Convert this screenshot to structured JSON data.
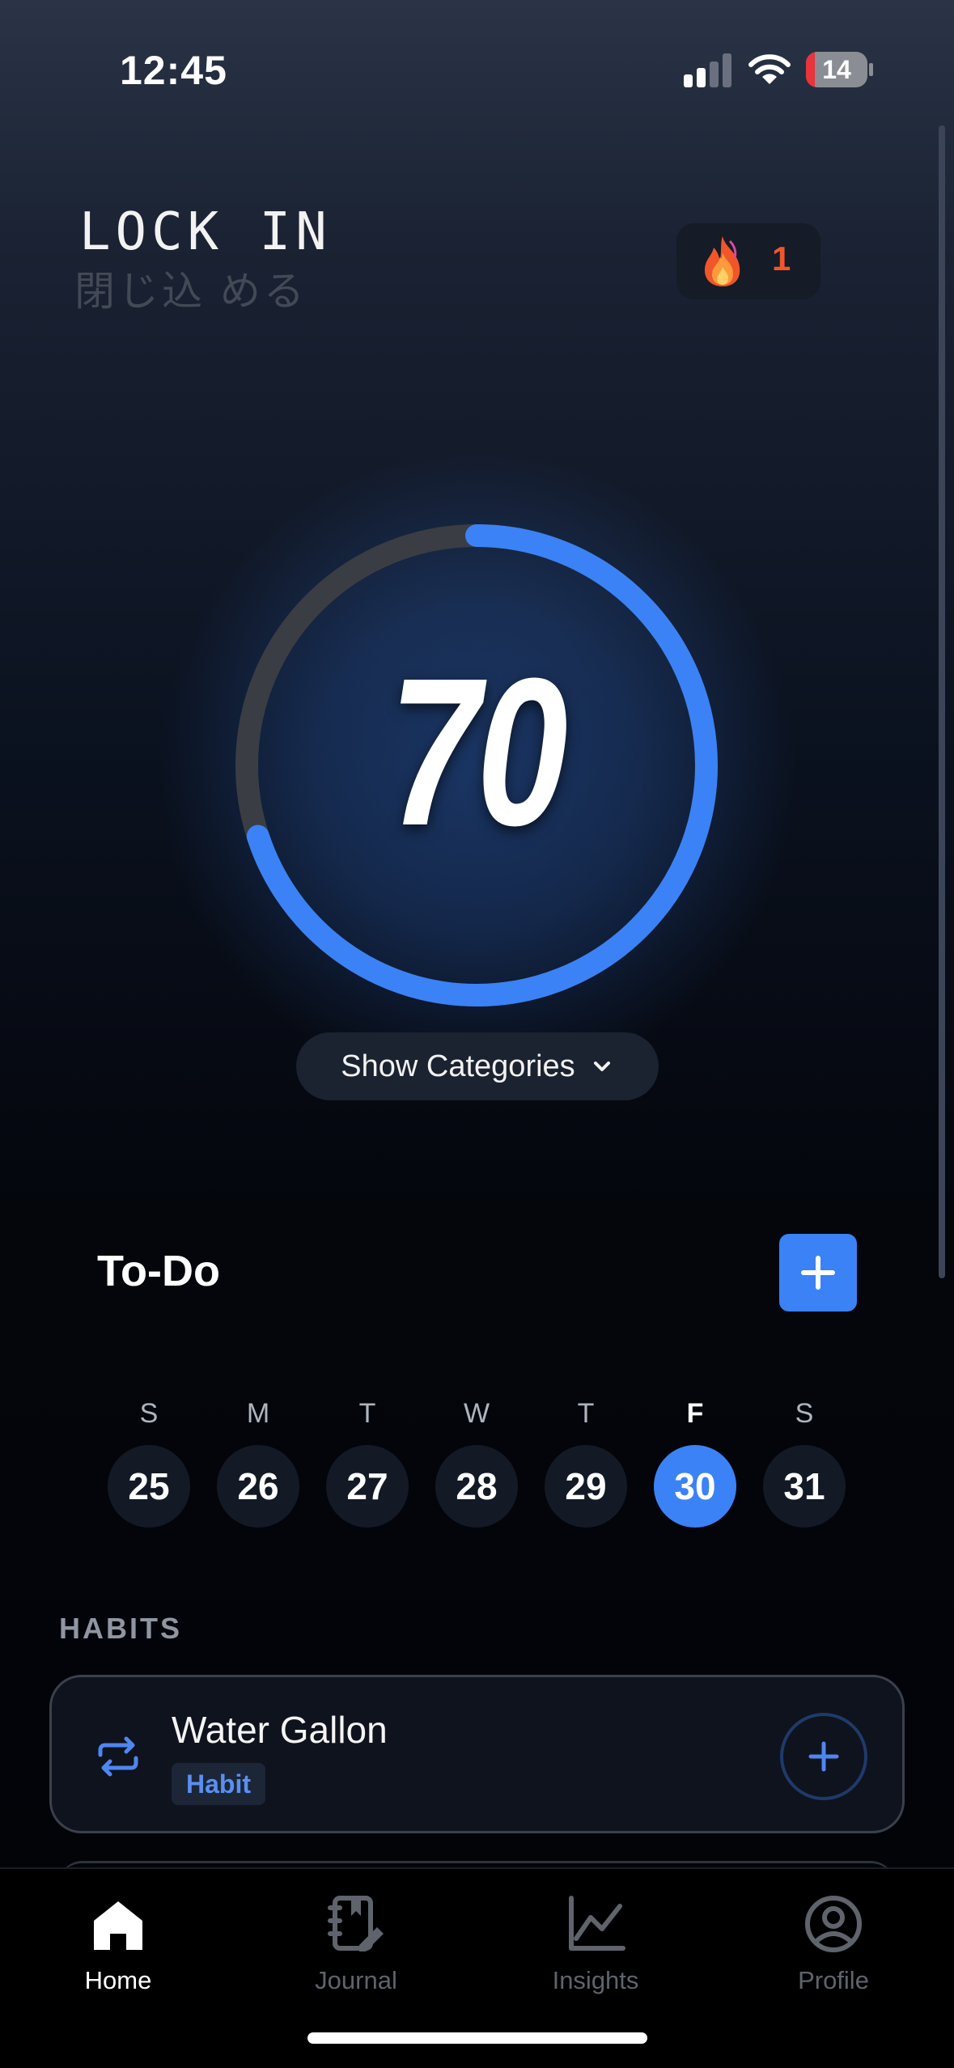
{
  "status_bar": {
    "time": "12:45",
    "battery": "14",
    "battery_level": 0.14
  },
  "header": {
    "title": "LOCK IN",
    "subtitle": "閉じ込 める",
    "streak_count": "1"
  },
  "score": {
    "value": "70",
    "progress": 0.7,
    "accent": "#3b82f6",
    "track": "#3a3d44"
  },
  "categories_button": {
    "label": "Show Categories"
  },
  "todo": {
    "title": "To-Do",
    "week": [
      {
        "dow": "S",
        "date": "25",
        "active": false
      },
      {
        "dow": "M",
        "date": "26",
        "active": false
      },
      {
        "dow": "T",
        "date": "27",
        "active": false
      },
      {
        "dow": "W",
        "date": "28",
        "active": false
      },
      {
        "dow": "T",
        "date": "29",
        "active": false
      },
      {
        "dow": "F",
        "date": "30",
        "active": true
      },
      {
        "dow": "S",
        "date": "31",
        "active": false
      }
    ]
  },
  "habits": {
    "heading": "HABITS",
    "items": [
      {
        "name": "Water Gallon",
        "tag": "Habit",
        "icon": "repeat-icon"
      }
    ]
  },
  "tabbar": {
    "items": [
      {
        "label": "Home",
        "icon": "home-icon",
        "active": true
      },
      {
        "label": "Journal",
        "icon": "journal-icon",
        "active": false
      },
      {
        "label": "Insights",
        "icon": "chart-icon",
        "active": false
      },
      {
        "label": "Profile",
        "icon": "profile-icon",
        "active": false
      }
    ]
  }
}
